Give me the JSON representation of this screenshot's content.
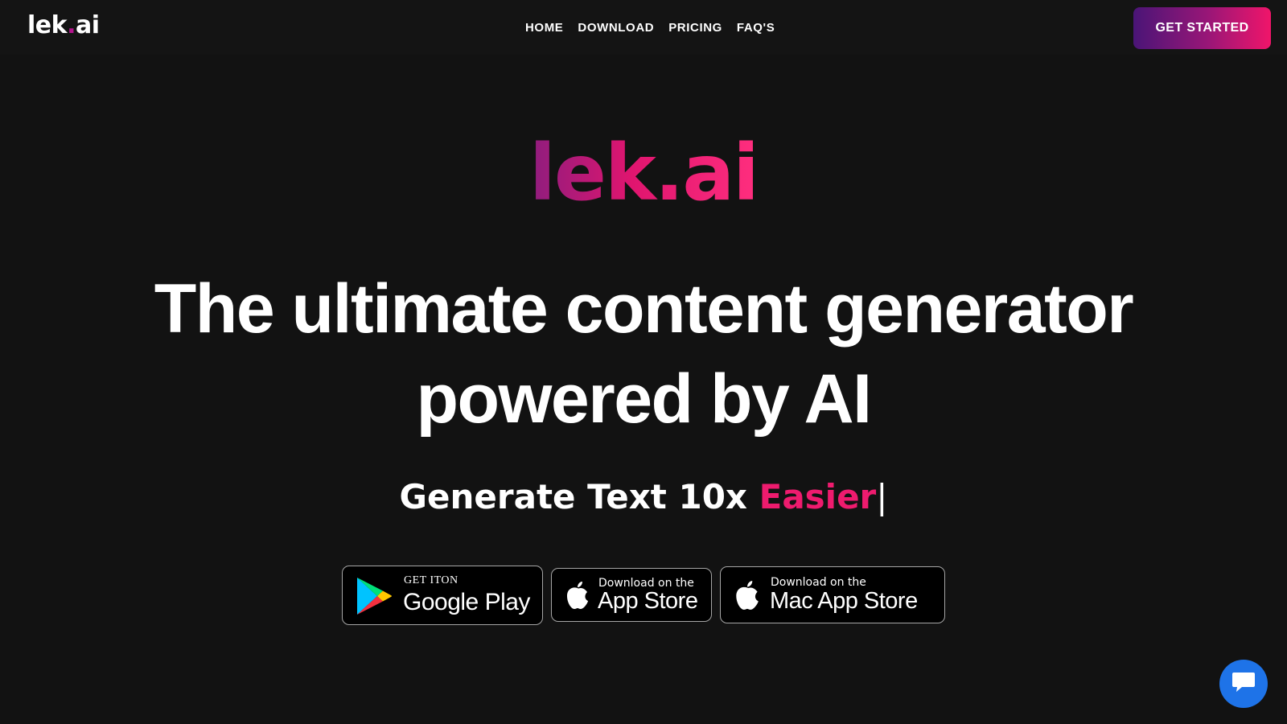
{
  "header": {
    "logo": {
      "text_main": "lek",
      "text_dot": ".",
      "text_tail": "ai"
    },
    "nav": [
      {
        "label": "HOME"
      },
      {
        "label": "DOWNLOAD"
      },
      {
        "label": "PRICING"
      },
      {
        "label": "FAQ'S"
      }
    ],
    "cta_label": "GET STARTED"
  },
  "hero": {
    "brand": "lek.ai",
    "headline_line1": "The ultimate content generator",
    "headline_line2": "powered by AI",
    "subline_prefix": "Generate Text 10x ",
    "subline_accent": "Easier",
    "subline_caret": "|"
  },
  "badges": {
    "google_play": {
      "small": "GET ITON",
      "big": "Google Play",
      "icon": "google-play-icon"
    },
    "app_store": {
      "small": "Download on the",
      "big": "App Store",
      "icon": "apple-icon"
    },
    "mac_app_store": {
      "small": "Download on the",
      "big": "Mac App Store",
      "icon": "apple-icon"
    }
  },
  "chat_widget": {
    "icon": "chat-bubble-icon"
  },
  "colors": {
    "background": "#121212",
    "accent_pink": "#ee1b6e",
    "cta_gradient_start": "#4a1577",
    "cta_gradient_end": "#f0156a",
    "chat_blue": "#1e73e8"
  }
}
